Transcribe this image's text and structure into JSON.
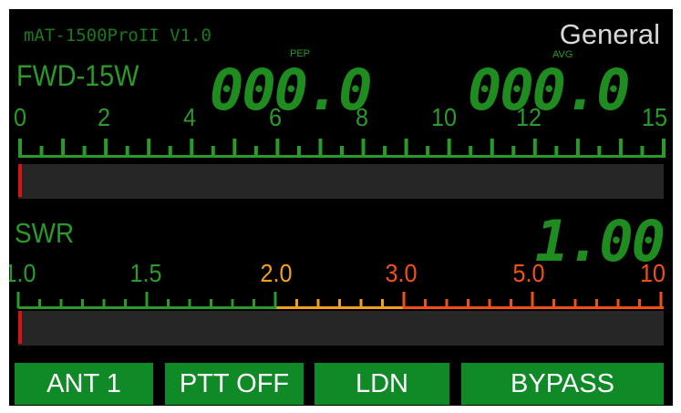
{
  "header": {
    "firmware": "mAT-1500ProII  V1.0",
    "mode": "General"
  },
  "power": {
    "label": "FWD-15W",
    "pep_tag": "PEP",
    "avg_tag": "AVG",
    "pep_value": "000.0",
    "avg_value": "000.0",
    "scale_labels": [
      "0",
      "2",
      "4",
      "6",
      "8",
      "10",
      "12",
      "15"
    ],
    "reading_fraction": 0.0
  },
  "swr": {
    "label": "SWR",
    "value": "1.00",
    "scale_labels": [
      "1.0",
      "1.5",
      "2.0",
      "3.0",
      "5.0",
      "10"
    ],
    "reading_fraction": 0.0
  },
  "colors": {
    "green": "#2a9a2a",
    "yellow": "#f0a020",
    "red": "#f05018",
    "needle": "#d41414",
    "button": "#0f8a26"
  },
  "buttons": {
    "ant": "ANT 1",
    "ptt": "PTT  OFF",
    "ldn": "LDN",
    "bypass": "BYPASS"
  }
}
